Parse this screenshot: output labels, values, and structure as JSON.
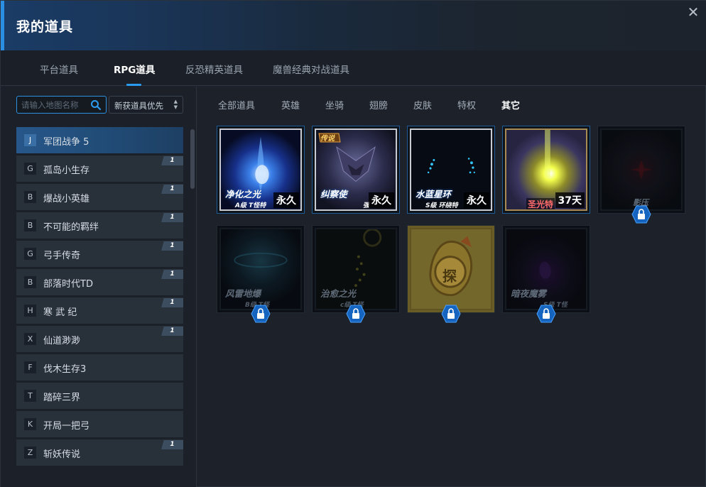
{
  "window": {
    "title": "我的道具",
    "close_icon": "close-icon",
    "close_glyph": "✕"
  },
  "main_tabs": [
    {
      "label": "平台道具",
      "active": false
    },
    {
      "label": "RPG道具",
      "active": true
    },
    {
      "label": "反恐精英道具",
      "active": false
    },
    {
      "label": "魔兽经典对战道具",
      "active": false
    }
  ],
  "search": {
    "placeholder": "请输入地图名称",
    "value": ""
  },
  "sort": {
    "selected": "新获道具优先",
    "arrows": "▲\n▼"
  },
  "maps": [
    {
      "letter": "J",
      "name": "军团战争 5",
      "badge": "",
      "active": true
    },
    {
      "letter": "G",
      "name": "孤岛小生存",
      "badge": "1"
    },
    {
      "letter": "B",
      "name": "爆战小英雄",
      "badge": "1"
    },
    {
      "letter": "B",
      "name": "不可能的羁绊",
      "badge": "1"
    },
    {
      "letter": "G",
      "name": "弓手传奇",
      "badge": "1"
    },
    {
      "letter": "B",
      "name": "部落时代TD",
      "badge": "1"
    },
    {
      "letter": "H",
      "name": "寒 武 纪",
      "badge": "1"
    },
    {
      "letter": "X",
      "name": "仙道渺渺",
      "badge": "1"
    },
    {
      "letter": "F",
      "name": "伐木生存3",
      "badge": ""
    },
    {
      "letter": "T",
      "name": "踏碎三界",
      "badge": ""
    },
    {
      "letter": "K",
      "name": "开局一把弓",
      "badge": ""
    },
    {
      "letter": "Z",
      "name": "斩妖传说",
      "badge": "1"
    }
  ],
  "sub_tabs": [
    {
      "label": "全部道具",
      "active": false
    },
    {
      "label": "英雄",
      "active": false
    },
    {
      "label": "坐骑",
      "active": false
    },
    {
      "label": "翅膀",
      "active": false
    },
    {
      "label": "皮肤",
      "active": false
    },
    {
      "label": "特权",
      "active": false
    },
    {
      "label": "其它",
      "active": true
    }
  ],
  "items": [
    {
      "name": "净化之光",
      "sub": "A级 T怪特",
      "duration": "永久",
      "locked": false
    },
    {
      "name": "纠察使",
      "sub": "强",
      "duration": "永久",
      "locked": false,
      "tag": "传说"
    },
    {
      "name": "水蓝星环",
      "sub": "S级 环绕特",
      "duration": "永久",
      "locked": false
    },
    {
      "name": "圣光特",
      "sub": "",
      "duration": "37天",
      "locked": false
    },
    {
      "name": "影压",
      "sub": "",
      "duration": "",
      "locked": true
    },
    {
      "name": "风雷地爆",
      "sub": "B级 T怪",
      "duration": "",
      "locked": true
    },
    {
      "name": "治愈之光",
      "sub": "c级 T怪",
      "duration": "",
      "locked": true
    },
    {
      "name": "探",
      "sub": "",
      "duration": "",
      "locked": true
    },
    {
      "name": "暗夜魔雾",
      "sub": "S级 T怪",
      "duration": "",
      "locked": true
    }
  ],
  "colors": {
    "accent": "#2a9cf0",
    "frame": "#1f5c97",
    "lock": "#1565c0"
  }
}
